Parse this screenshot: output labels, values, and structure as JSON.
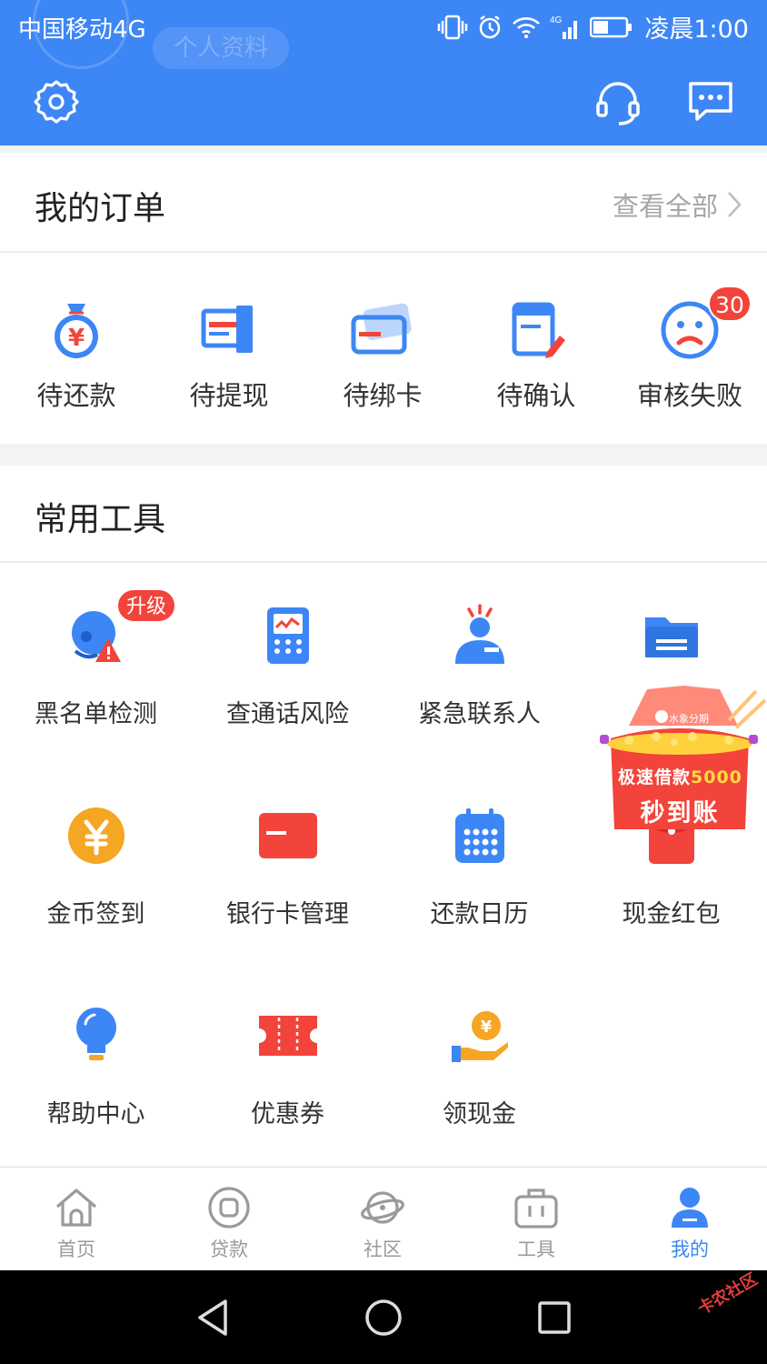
{
  "status_bar": {
    "carrier": "中国移动4G",
    "network": "4G",
    "time": "凌晨1:00"
  },
  "header": {
    "ghost_label": "个人资料",
    "settings_icon": "gear-icon",
    "service_icon": "headset-icon",
    "message_icon": "chat-bubble-icon",
    "bg_color": "#3d86f5"
  },
  "orders": {
    "title": "我的订单",
    "view_all": "查看全部",
    "items": [
      {
        "label": "待还款",
        "icon": "money-bag-icon"
      },
      {
        "label": "待提现",
        "icon": "withdraw-icon"
      },
      {
        "label": "待绑卡",
        "icon": "bank-card-icon"
      },
      {
        "label": "待确认",
        "icon": "confirm-document-icon"
      },
      {
        "label": "审核失败",
        "icon": "sad-face-icon",
        "badge": "30"
      }
    ]
  },
  "tools": {
    "title": "常用工具",
    "items": [
      {
        "label": "黑名单检测",
        "icon": "blacklist-check-icon",
        "badge": "升级"
      },
      {
        "label": "查通话风险",
        "icon": "phone-risk-icon"
      },
      {
        "label": "紧急联系人",
        "icon": "emergency-contact-icon"
      },
      {
        "label": "",
        "icon": "folder-icon"
      },
      {
        "label": "金币签到",
        "icon": "gold-coin-icon"
      },
      {
        "label": "银行卡管理",
        "icon": "bank-card-manage-icon"
      },
      {
        "label": "还款日历",
        "icon": "calendar-icon"
      },
      {
        "label": "现金红包",
        "icon": "red-envelope-icon"
      },
      {
        "label": "帮助中心",
        "icon": "lightbulb-icon"
      },
      {
        "label": "优惠券",
        "icon": "coupon-icon"
      },
      {
        "label": "领现金",
        "icon": "cash-hand-icon"
      }
    ]
  },
  "promo": {
    "brand": "水象分期",
    "line1_prefix": "极速借款",
    "line1_amount": "5000",
    "line2": "秒到账"
  },
  "bottom_nav": {
    "items": [
      {
        "label": "首页",
        "icon": "home-icon",
        "active": false
      },
      {
        "label": "贷款",
        "icon": "loan-icon",
        "active": false
      },
      {
        "label": "社区",
        "icon": "community-icon",
        "active": false
      },
      {
        "label": "工具",
        "icon": "toolbox-icon",
        "active": false
      },
      {
        "label": "我的",
        "icon": "profile-icon",
        "active": true
      }
    ]
  },
  "system_nav": {
    "back_icon": "back-triangle-icon",
    "home_icon": "home-circle-icon",
    "recents_icon": "recents-square-icon"
  },
  "watermark": "卡农社区",
  "colors": {
    "primary": "#3d86f5",
    "red": "#f2443a",
    "orange": "#f5a623",
    "text": "#333333",
    "muted": "#a6a6a6"
  }
}
